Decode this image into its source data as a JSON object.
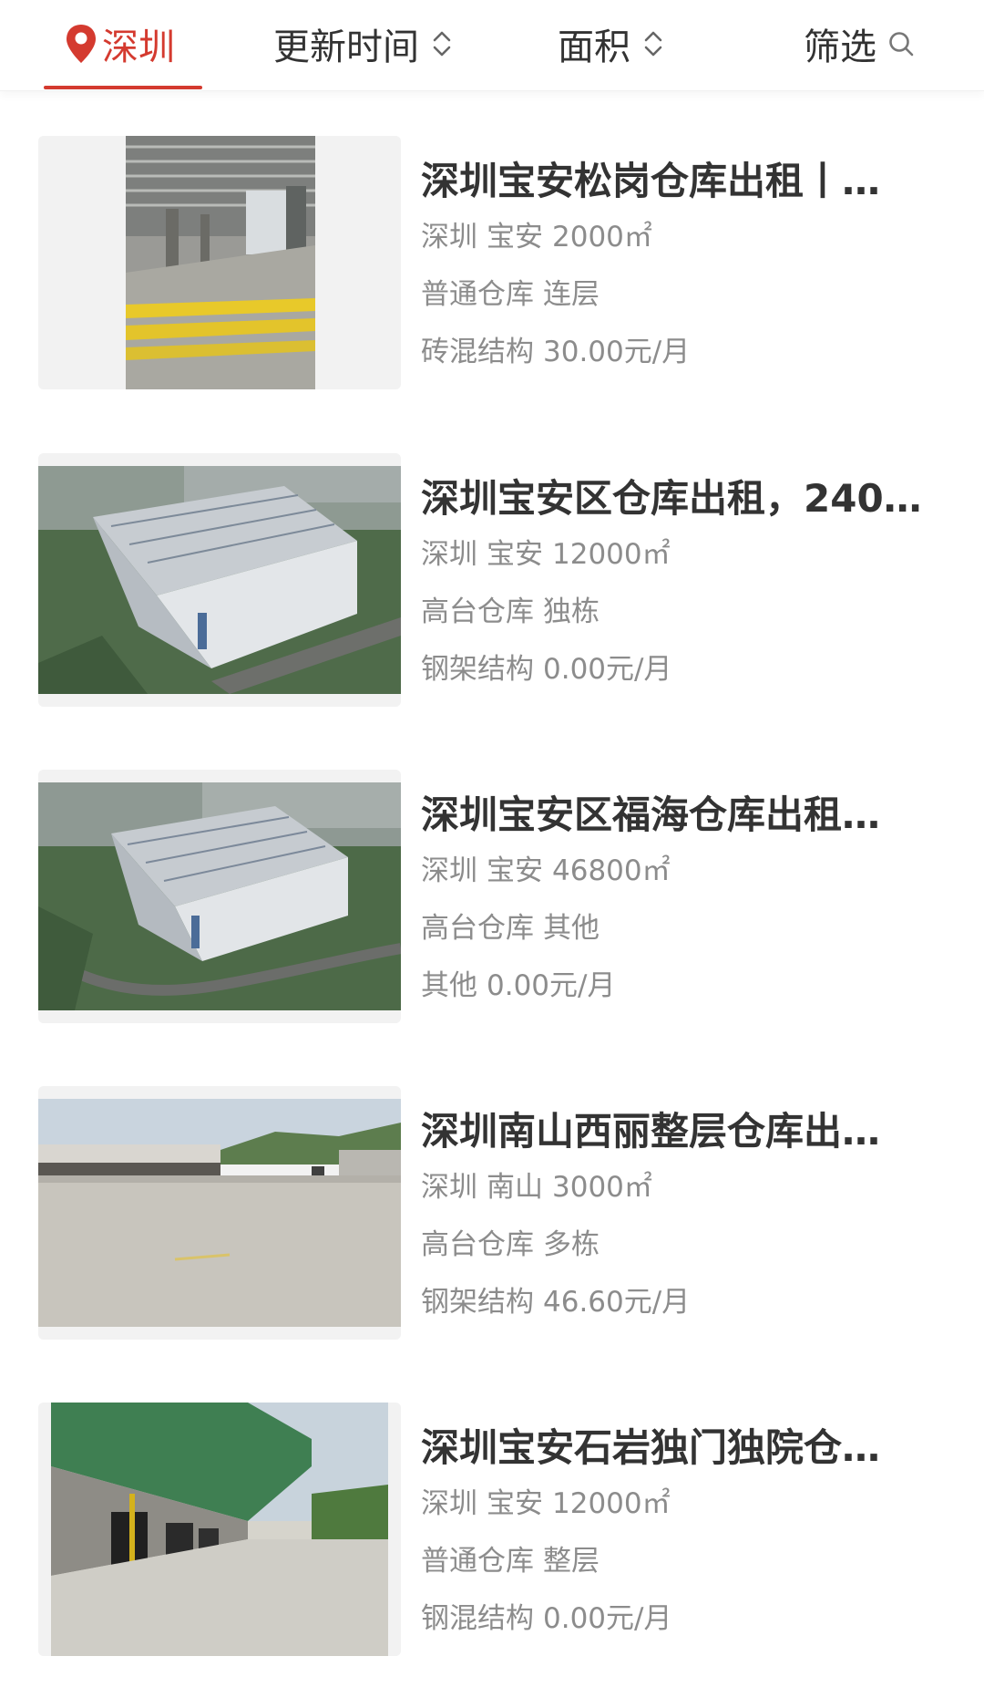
{
  "filter_bar": {
    "city": "深圳",
    "sort_update": "更新时间",
    "sort_area": "面积",
    "filter": "筛选"
  },
  "listings": [
    {
      "title": "深圳宝安松岗仓库出租丨…",
      "city": "深圳",
      "district": "宝安",
      "area": "2000㎡",
      "type": "普通仓库",
      "floor": "连层",
      "structure": "砖混结构",
      "price": "30.00元/月"
    },
    {
      "title": "深圳宝安区仓库出租，240…",
      "city": "深圳",
      "district": "宝安",
      "area": "12000㎡",
      "type": "高台仓库",
      "floor": "独栋",
      "structure": "钢架结构",
      "price": "0.00元/月"
    },
    {
      "title": "深圳宝安区福海仓库出租…",
      "city": "深圳",
      "district": "宝安",
      "area": "46800㎡",
      "type": "高台仓库",
      "floor": "其他",
      "structure": "其他",
      "price": "0.00元/月"
    },
    {
      "title": "深圳南山西丽整层仓库出…",
      "city": "深圳",
      "district": "南山",
      "area": "3000㎡",
      "type": "高台仓库",
      "floor": "多栋",
      "structure": "钢架结构",
      "price": "46.60元/月"
    },
    {
      "title": "深圳宝安石岩独门独院仓…",
      "city": "深圳",
      "district": "宝安",
      "area": "12000㎡",
      "type": "普通仓库",
      "floor": "整层",
      "structure": "钢混结构",
      "price": "0.00元/月"
    }
  ],
  "colors": {
    "accent": "#d43a2f",
    "title_text": "#333333",
    "meta_text": "#8c8c8c"
  }
}
